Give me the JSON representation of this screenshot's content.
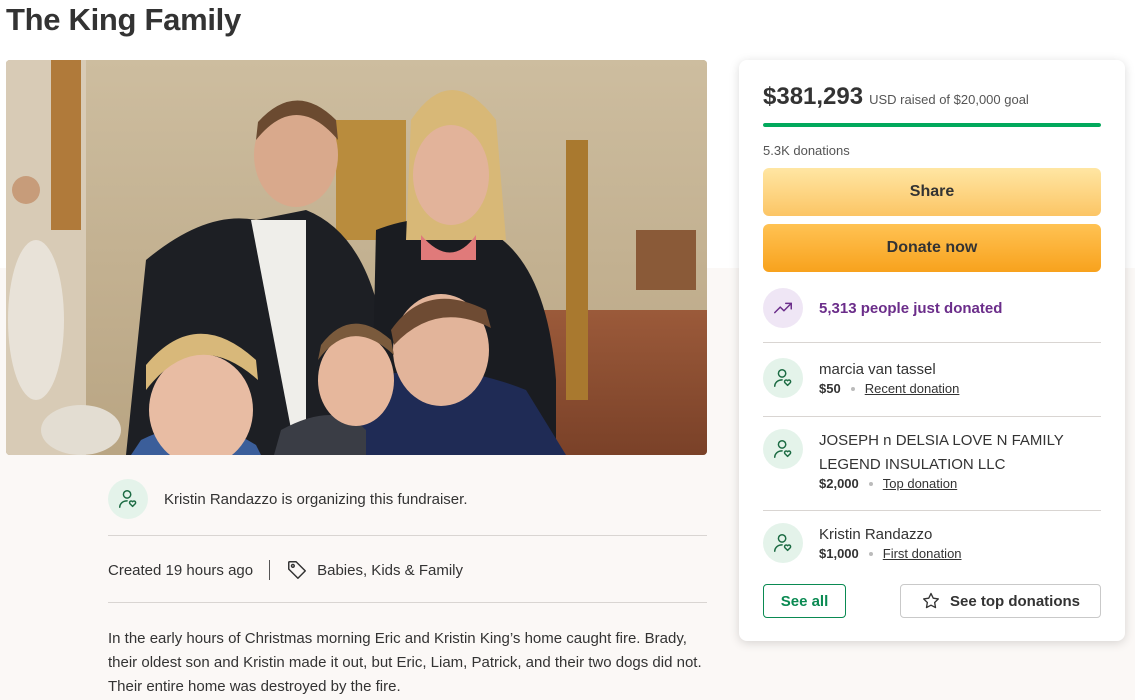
{
  "page": {
    "title": "The King Family"
  },
  "hero": {
    "image_alt": "Family photo of Eric, Kristin and their three sons in a church"
  },
  "organizer": {
    "text": "Kristin Randazzo is organizing this fundraiser."
  },
  "meta": {
    "created": "Created 19 hours ago",
    "category": "Babies, Kids & Family"
  },
  "story": {
    "text": "In the early hours of Christmas morning Eric and Kristin King’s home caught fire. Brady, their oldest son and Kristin made it out, but Eric, Liam, Patrick, and their two dogs did not. Their entire home was destroyed by the fire."
  },
  "donation_card": {
    "amount": "$381,293",
    "goal_text": "USD raised of $20,000 goal",
    "progress_fraction": 1.0,
    "donations_count": "5.3K donations",
    "share_label": "Share",
    "donate_label": "Donate now",
    "trend_text": "5,313 people just donated",
    "donors": [
      {
        "name": "marcia van tassel",
        "amount": "$50",
        "type": "Recent donation"
      },
      {
        "name": "JOSEPH n DELSIA LOVE N FAMILY LEGEND INSULATION LLC",
        "amount": "$2,000",
        "type": "Top donation"
      },
      {
        "name": "Kristin Randazzo",
        "amount": "$1,000",
        "type": "First donation"
      }
    ],
    "see_all_label": "See all",
    "see_top_label": "See top donations"
  },
  "colors": {
    "accent_green": "#02a95c",
    "trend_purple": "#6b2d8a",
    "share_yellow": "#fcc565",
    "donate_orange": "#f8a21d"
  },
  "icons": [
    "heart-hand-icon",
    "tag-icon",
    "trend-up-icon",
    "star-icon"
  ]
}
